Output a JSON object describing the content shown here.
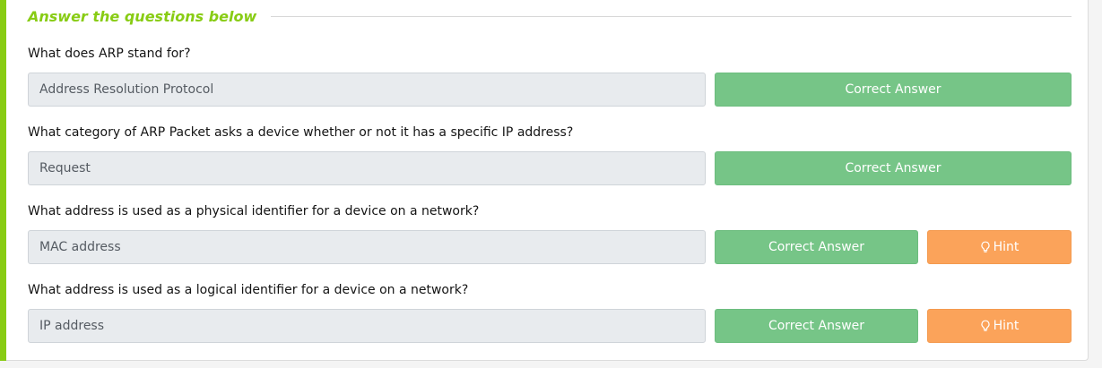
{
  "section": {
    "title": "Answer the questions below"
  },
  "questions": [
    {
      "text": "What does ARP stand for?",
      "answer": "Address Resolution Protocol",
      "status_label": "Correct Answer"
    },
    {
      "text": "What category of ARP Packet asks a device whether or not it has a specific IP address?",
      "answer": "Request",
      "status_label": "Correct Answer"
    },
    {
      "text": "What address is used as a physical identifier for a device on a network?",
      "answer": "MAC address",
      "status_label": "Correct Answer",
      "hint_label": "Hint"
    },
    {
      "text": "What address is used as a logical identifier for a device on a network?",
      "answer": "IP address",
      "status_label": "Correct Answer",
      "hint_label": "Hint"
    }
  ],
  "icons": {
    "hint": "lightbulb-icon"
  },
  "colors": {
    "accent": "#88cc14",
    "correct": "#76c587",
    "hint": "#fba35a",
    "field_bg": "#e8ebee"
  }
}
